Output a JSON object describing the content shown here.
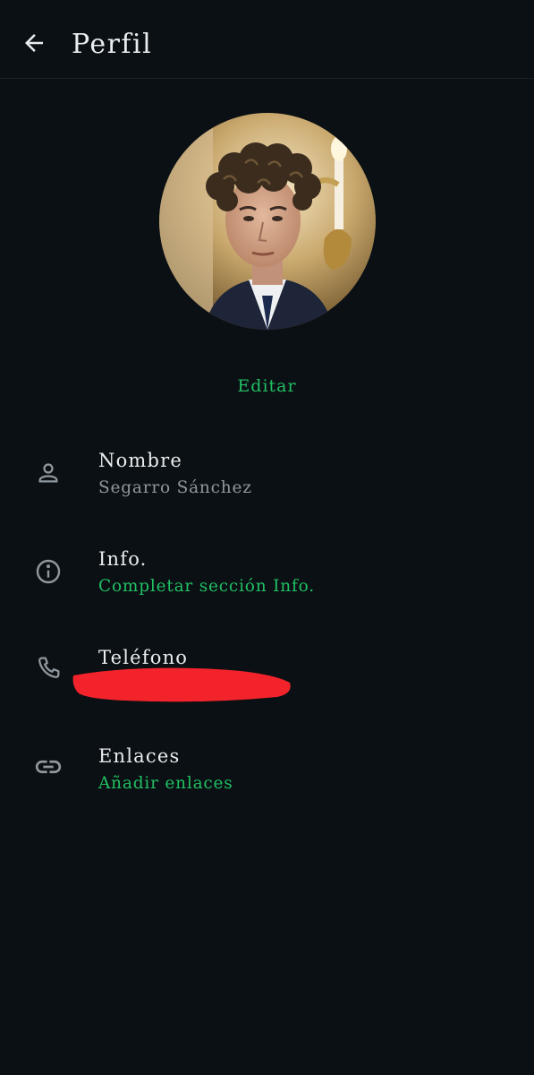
{
  "header": {
    "back_icon": "arrow-left-icon",
    "title": "Perfil"
  },
  "profile": {
    "edit_label": "Editar"
  },
  "fields": {
    "name": {
      "icon": "person-icon",
      "label": "Nombre",
      "value": "Segarro Sánchez"
    },
    "info": {
      "icon": "info-icon",
      "label": "Info.",
      "value": "Completar sección Info."
    },
    "phone": {
      "icon": "phone-icon",
      "label": "Teléfono"
    },
    "links": {
      "icon": "link-icon",
      "label": "Enlaces",
      "value": "Añadir enlaces"
    }
  },
  "colors": {
    "background": "#0b1014",
    "accent_green": "#21c063",
    "text_primary": "#e9edef",
    "text_secondary": "#8f989e",
    "redaction_red": "#f2232b"
  }
}
